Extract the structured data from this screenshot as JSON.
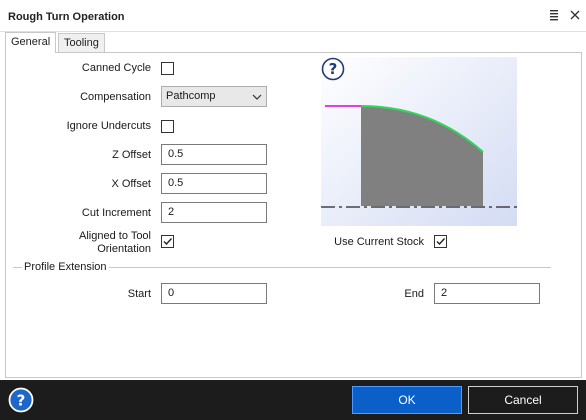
{
  "window": {
    "title": "Rough Turn Operation"
  },
  "tabs": [
    {
      "label": "General",
      "active": true
    },
    {
      "label": "Tooling",
      "active": false
    }
  ],
  "general": {
    "canned_cycle": {
      "label": "Canned Cycle",
      "checked": false
    },
    "compensation": {
      "label": "Compensation",
      "value": "Pathcomp"
    },
    "ignore_undercuts": {
      "label": "Ignore Undercuts",
      "checked": false
    },
    "z_offset": {
      "label": "Z Offset",
      "value": "0.5"
    },
    "x_offset": {
      "label": "X Offset",
      "value": "0.5"
    },
    "cut_increment": {
      "label": "Cut Increment",
      "value": "2"
    },
    "aligned_to_tool": {
      "label_line1": "Aligned to Tool",
      "label_line2": "Orientation",
      "checked": true
    },
    "use_current_stock": {
      "label": "Use Current Stock",
      "checked": true
    }
  },
  "profile_extension": {
    "title": "Profile Extension",
    "start": {
      "label": "Start",
      "value": "0"
    },
    "end": {
      "label": "End",
      "value": "2"
    }
  },
  "footer": {
    "ok_label": "OK",
    "cancel_label": "Cancel"
  },
  "colors": {
    "ok_button": "#0a5fc8",
    "footer_bg": "#1c1c1c",
    "help_icon": "#1e66c7",
    "profile_green": "#2fd65b",
    "extension_magenta": "#e040e0",
    "stock_gray": "#808080"
  },
  "icons": {
    "title_menu": "hamburger-icon",
    "title_close": "close-icon",
    "preview_help": "question-icon",
    "footer_help": "help-icon",
    "dropdown": "chevron-down-icon"
  }
}
